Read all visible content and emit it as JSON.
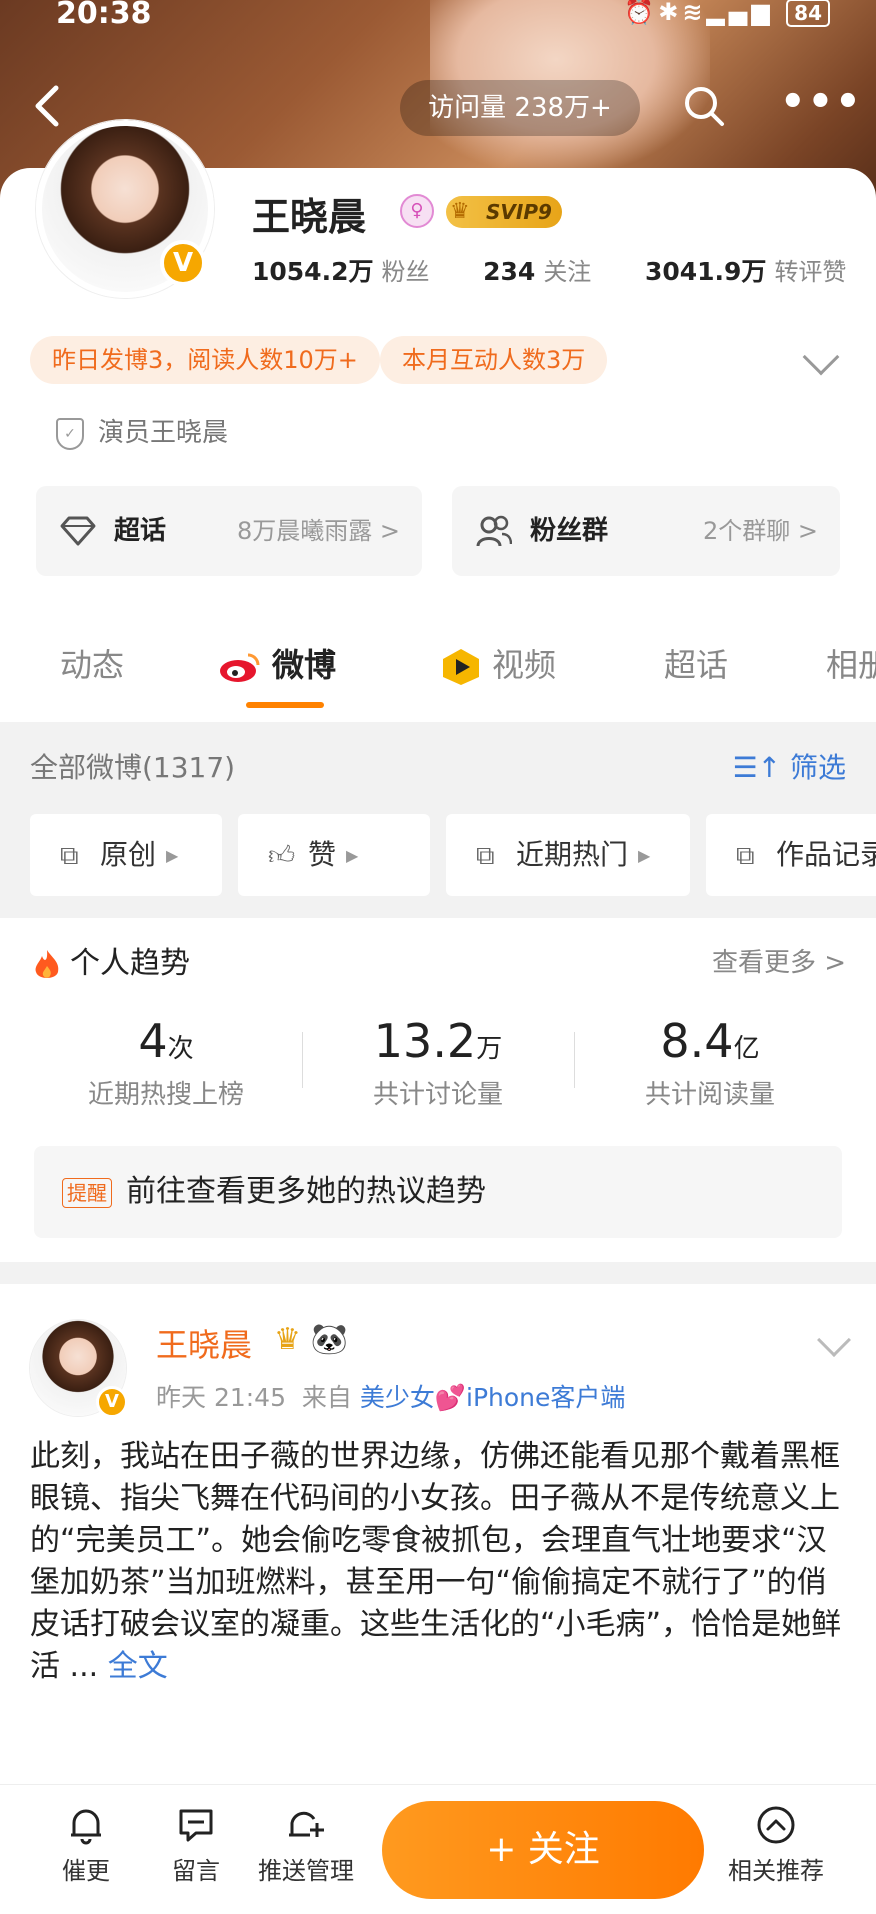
{
  "status_bar": {
    "time": "20:38",
    "battery": "84"
  },
  "top_nav": {
    "visits": "访问量 238万+"
  },
  "profile": {
    "name": "王晓晨",
    "svip": "SVIP9",
    "followers_num": "1054.2万",
    "followers_label": "粉丝",
    "following_num": "234",
    "following_label": "关注",
    "engagement_num": "3041.9万",
    "engagement_label": "转评赞",
    "chips": [
      "昨日发博3，阅读人数10万+",
      "本月互动人数3万"
    ],
    "certification": "演员王晓晨",
    "supertopic": {
      "title": "超话",
      "sub": "8万晨曦雨露 >"
    },
    "fangroup": {
      "title": "粉丝群",
      "sub": "2个群聊 >"
    }
  },
  "tabs": [
    "动态",
    "微博",
    "视频",
    "超话",
    "相册"
  ],
  "filters": {
    "all_count": "全部微博(1317)",
    "filter_label": "筛选",
    "chips": [
      "原创",
      "赞",
      "近期热门",
      "作品记录"
    ]
  },
  "trend": {
    "title": "个人趋势",
    "see_more": "查看更多 >",
    "metrics": [
      {
        "value": "4",
        "unit": "次",
        "label": "近期热搜上榜"
      },
      {
        "value": "13.2",
        "unit": "万",
        "label": "共计讨论量"
      },
      {
        "value": "8.4",
        "unit": "亿",
        "label": "共计阅读量"
      }
    ],
    "remind_tag": "提醒",
    "remind_text": "前往查看更多她的热议趋势"
  },
  "post": {
    "author": "王晓晨",
    "time": "昨天 21:45",
    "from_label": "来自",
    "source": "美少女💕iPhone客户端",
    "text": "此刻，我站在田子薇的世界边缘，仿佛还能看见那个戴着黑框眼镜、指尖飞舞在代码间的小女孩。田子薇从不是传统意义上的“完美员工”。她会偷吃零食被抓包，会理直气壮地要求“汉堡加奶茶”当加班燃料，甚至用一句“偷偷搞定不就行了”的俏皮话打破会议室的凝重。这些生活化的“小毛病”，恰恰是她鲜活 ...",
    "full_link": "全文"
  },
  "bottom_bar": {
    "items": [
      "催更",
      "留言",
      "推送管理"
    ],
    "follow": "+ 关注",
    "recommend": "相关推荐"
  },
  "colors": {
    "accent": "#ff8200",
    "link": "#3d7bd6",
    "orange_text": "#f06b1d"
  }
}
